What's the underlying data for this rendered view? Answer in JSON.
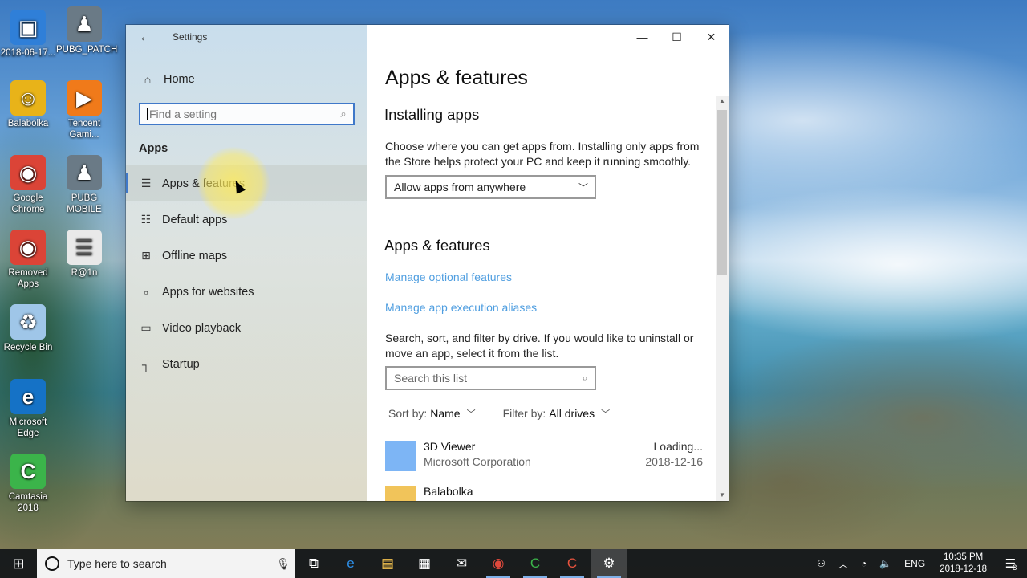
{
  "desktop": {
    "icons": [
      {
        "label": "2018-06-17...",
        "glyph": "▣",
        "color": "#2f7fd8",
        "icon": "screenshot-file-icon"
      },
      {
        "label": "PUBG_PATCH",
        "glyph": "♟",
        "color": "#6a7a86",
        "icon": "pubg-patch-icon"
      },
      {
        "label": "Balabolka",
        "glyph": "☺",
        "color": "#e8b319",
        "icon": "balabolka-icon"
      },
      {
        "label": "Tencent Gami...",
        "glyph": "▶",
        "color": "#f07a1a",
        "icon": "tencent-gaming-icon"
      },
      {
        "label": "Google Chrome",
        "glyph": "◉",
        "color": "#db4437",
        "icon": "chrome-icon"
      },
      {
        "label": "PUBG MOBILE",
        "glyph": "♟",
        "color": "#6a7a86",
        "icon": "pubg-mobile-icon"
      },
      {
        "label": "Removed Apps",
        "glyph": "◉",
        "color": "#db4437",
        "icon": "chrome-removed-apps-icon"
      },
      {
        "label": "R@1n",
        "glyph": "☰",
        "color": "#e9e9e9",
        "icon": "document-icon"
      },
      {
        "label": "Recycle Bin",
        "glyph": "♻",
        "color": "#9fc6e8",
        "icon": "recycle-bin-icon"
      },
      {
        "label": "Microsoft Edge",
        "glyph": "e",
        "color": "#1572c6",
        "icon": "edge-icon"
      },
      {
        "label": "Camtasia 2018",
        "glyph": "C",
        "color": "#3bb44a",
        "icon": "camtasia-icon"
      }
    ]
  },
  "window": {
    "title": "Settings",
    "back_glyph": "←",
    "minimize_glyph": "—",
    "maximize_glyph": "☐",
    "close_glyph": "✕"
  },
  "sidebar": {
    "home_label": "Home",
    "search_placeholder": "Find a setting",
    "section_label": "Apps",
    "items": [
      {
        "label": "Apps & features",
        "glyph": "☰",
        "active": true
      },
      {
        "label": "Default apps",
        "glyph": "☷",
        "active": false
      },
      {
        "label": "Offline maps",
        "glyph": "⊞",
        "active": false
      },
      {
        "label": "Apps for websites",
        "glyph": "▫",
        "active": false
      },
      {
        "label": "Video playback",
        "glyph": "▭",
        "active": false
      },
      {
        "label": "Startup",
        "glyph": "┐",
        "active": false
      }
    ]
  },
  "main": {
    "page_title": "Apps & features",
    "installing_heading": "Installing apps",
    "installing_text": "Choose where you can get apps from. Installing only apps from the Store helps protect your PC and keep it running smoothly.",
    "source_dropdown_value": "Allow apps from anywhere",
    "features_heading": "Apps & features",
    "link_optional": "Manage optional features",
    "link_aliases": "Manage app execution aliases",
    "list_text": "Search, sort, and filter by drive. If you would like to uninstall or move an app, select it from the list.",
    "list_search_placeholder": "Search this list",
    "sort_label": "Sort by:",
    "sort_value": "Name",
    "filter_label": "Filter by:",
    "filter_value": "All drives",
    "apps": [
      {
        "name": "3D Viewer",
        "publisher": "Microsoft Corporation",
        "size": "Loading...",
        "date": "2018-12-16"
      },
      {
        "name": "Balabolka",
        "publisher": "",
        "size": "",
        "date": ""
      }
    ]
  },
  "taskbar": {
    "search_placeholder": "Type here to search",
    "apps": [
      {
        "icon": "task-view-icon",
        "glyph": "⧉",
        "color": "#ffffff",
        "running": false,
        "active": false
      },
      {
        "icon": "edge-icon",
        "glyph": "e",
        "color": "#2d8fe8",
        "running": false,
        "active": false
      },
      {
        "icon": "file-explorer-icon",
        "glyph": "▤",
        "color": "#f2c14e",
        "running": false,
        "active": false
      },
      {
        "icon": "store-icon",
        "glyph": "▦",
        "color": "#ffffff",
        "running": false,
        "active": false
      },
      {
        "icon": "mail-icon",
        "glyph": "✉",
        "color": "#ffffff",
        "running": false,
        "active": false
      },
      {
        "icon": "chrome-icon",
        "glyph": "◉",
        "color": "#e0493c",
        "running": true,
        "active": false
      },
      {
        "icon": "camtasia-icon",
        "glyph": "C",
        "color": "#3bb44a",
        "running": true,
        "active": false
      },
      {
        "icon": "camtasia-recorder-icon",
        "glyph": "C",
        "color": "#e8533e",
        "running": true,
        "active": false
      },
      {
        "icon": "settings-gear-icon",
        "glyph": "⚙",
        "color": "#ffffff",
        "running": true,
        "active": true
      }
    ],
    "language": "ENG",
    "time": "10:35 PM",
    "date": "2018-12-18",
    "notification_count": "3"
  }
}
